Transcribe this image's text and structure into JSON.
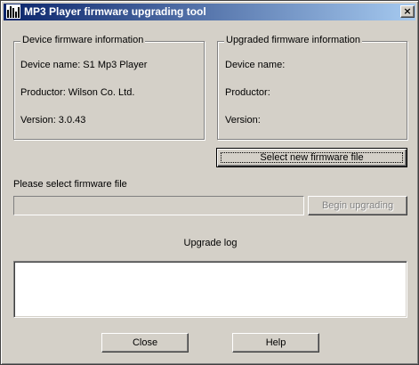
{
  "window": {
    "title": "MP3 Player firmware upgrading tool",
    "close_glyph": "×",
    "app_icon": "equalizer-bars-icon"
  },
  "device_info": {
    "group_title": "Device firmware information",
    "device_name": "Device name: S1 Mp3 Player",
    "productor": "Productor: Wilson Co. Ltd.",
    "version": "Version: 3.0.43"
  },
  "upgraded_info": {
    "group_title": "Upgraded firmware information",
    "device_name": "Device name:",
    "productor": "Productor:",
    "version": "Version:"
  },
  "buttons": {
    "select_file": "Select new firmware file",
    "begin_upgrading": "Begin upgrading",
    "close": "Close",
    "help": "Help"
  },
  "firmware": {
    "prompt": "Please select firmware file",
    "progress_percent": 0
  },
  "log": {
    "label": "Upgrade log",
    "content": ""
  }
}
